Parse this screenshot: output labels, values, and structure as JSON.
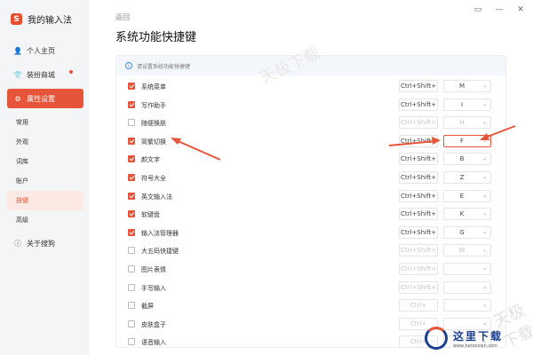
{
  "app": {
    "title": "我的输入法"
  },
  "window": {
    "controls": [
      "▭",
      "—",
      "✕"
    ]
  },
  "sidebar": {
    "items": [
      {
        "icon": "👤",
        "label": "个人主页"
      },
      {
        "icon": "👕",
        "label": "装扮商城"
      },
      {
        "icon": "⚙",
        "label": "属性设置"
      }
    ],
    "sub_items": [
      "常用",
      "外观",
      "词库",
      "账户",
      "按键",
      "高级"
    ],
    "about": {
      "icon": "ⓘ",
      "label": "关于搜狗"
    }
  },
  "header": {
    "back": "返回",
    "title": "系统功能快捷键"
  },
  "tip": "请设置系统功能快捷键",
  "rows": [
    {
      "label": "系统菜单",
      "checked": true,
      "combo": "Ctrl+Shift+",
      "key": "M"
    },
    {
      "label": "写作助手",
      "checked": true,
      "combo": "Ctrl+Shift+",
      "key": "I"
    },
    {
      "label": "随便换肤",
      "checked": false,
      "combo": "Ctrl+Shift+",
      "key": "H"
    },
    {
      "label": "简繁切换",
      "checked": true,
      "combo": "Ctrl+Shift+",
      "key": "F"
    },
    {
      "label": "颜文字",
      "checked": true,
      "combo": "Ctrl+Shift+",
      "key": "B"
    },
    {
      "label": "符号大全",
      "checked": true,
      "combo": "Ctrl+Shift+",
      "key": "Z"
    },
    {
      "label": "英文输入法",
      "checked": true,
      "combo": "Ctrl+Shift+",
      "key": "E"
    },
    {
      "label": "软键盘",
      "checked": true,
      "combo": "Ctrl+Shift+",
      "key": "K"
    },
    {
      "label": "输入法管理器",
      "checked": true,
      "combo": "Ctrl+Shift+",
      "key": "G"
    },
    {
      "label": "大五码快捷键",
      "checked": false,
      "combo": "Ctrl+Shift+",
      "key": "W"
    },
    {
      "label": "图片表情",
      "checked": false,
      "combo": "Ctrl+Shift+",
      "key": ""
    },
    {
      "label": "手写输入",
      "checked": false,
      "combo": "Ctrl+Shift+",
      "key": ""
    },
    {
      "label": "截屏",
      "checked": false,
      "combo": "Ctrl+",
      "key": ""
    },
    {
      "label": "皮肤盒子",
      "checked": false,
      "combo": "Ctrl+",
      "key": ""
    },
    {
      "label": "语音输入",
      "checked": false,
      "combo": "Ctrl+",
      "key": ""
    }
  ],
  "watermark": {
    "text": "天极下载",
    "brand_cn": "这里下载",
    "brand_url": "www.herecown.com"
  },
  "colors": {
    "accent": "#e6543a",
    "brand": "#1d3f8f"
  }
}
